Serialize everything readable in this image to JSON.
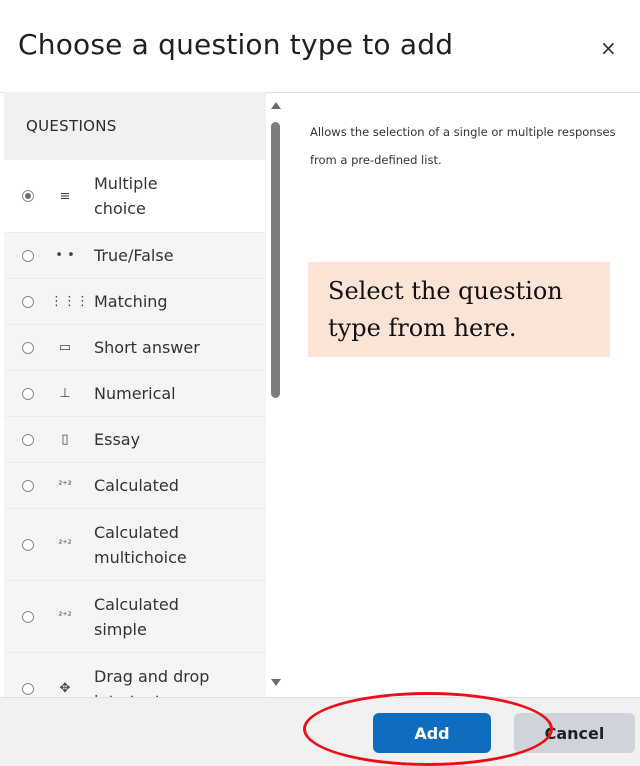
{
  "dialog": {
    "title": "Choose a question type to add",
    "close_glyph": "×"
  },
  "questions": {
    "header": "QUESTIONS",
    "items": [
      {
        "label": "Multiple choice",
        "icon": "≡",
        "icon_name": "list-icon",
        "selected": true
      },
      {
        "label": "True/False",
        "icon": "• •",
        "icon_name": "two-dots-icon",
        "selected": false
      },
      {
        "label": "Matching",
        "icon": "⋮⋮⋮",
        "icon_name": "matching-grid-icon",
        "selected": false
      },
      {
        "label": "Short answer",
        "icon": "▭",
        "icon_name": "short-answer-box-icon",
        "selected": false
      },
      {
        "label": "Numerical",
        "icon": "⊥",
        "icon_name": "numerical-icon",
        "selected": false
      },
      {
        "label": "Essay",
        "icon": "▯",
        "icon_name": "essay-page-icon",
        "selected": false
      },
      {
        "label": "Calculated",
        "icon": "²⁺²",
        "icon_name": "calculated-icon",
        "selected": false
      },
      {
        "label": "Calculated multichoice",
        "icon": "²⁺²",
        "icon_name": "calculated-multichoice-icon",
        "selected": false
      },
      {
        "label": "Calculated simple",
        "icon": "²⁺²",
        "icon_name": "calculated-simple-icon",
        "selected": false
      },
      {
        "label": "Drag and drop into text",
        "icon": "✥",
        "icon_name": "move-arrows-icon",
        "selected": false
      }
    ]
  },
  "description": "Allows the selection of a single or multiple responses from a pre-defined list.",
  "callout": "Select the question type from here.",
  "buttons": {
    "add": "Add",
    "cancel": "Cancel"
  },
  "colors": {
    "primary": "#0f6cbf",
    "secondary": "#ced4da",
    "callout_bg": "#fbe4d6",
    "annotation": "#e8101a"
  }
}
